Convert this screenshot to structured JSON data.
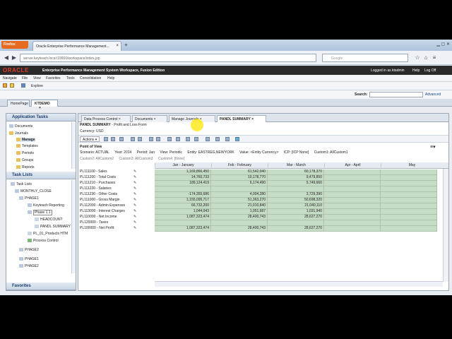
{
  "browser": {
    "firefox_button": "Firefox",
    "tab_title": "Oracle Enterprise Performance Management...",
    "url": "server.keyteach.local:19000/workspace/index.jsp",
    "search_placeholder": "Google"
  },
  "header": {
    "logo": "ORACLE",
    "app_title": "Enterprise Performance Management System Workspace, Fusion Edition",
    "logged_in": "Logged in as ktadmin",
    "help": "Help",
    "log_off": "Log Off"
  },
  "menu": [
    "Navigate",
    "File",
    "View",
    "Favorites",
    "Tools",
    "Consolidation",
    "Help"
  ],
  "toolbar": {
    "explore": "Explore"
  },
  "search": {
    "label": "Search:",
    "advanced": "Advanced"
  },
  "app_tabs": [
    "HomePage",
    "KTDEMO"
  ],
  "application_tasks": {
    "title": "Application Tasks",
    "items": [
      "Documents",
      "Journals",
      "Manage",
      "Templates",
      "Periods",
      "Groups",
      "Reports"
    ]
  },
  "task_lists": {
    "title": "Task Lists",
    "items": [
      "Task Lists",
      "MONTHLY_CLOSE",
      "PHASE1",
      "Keyteach Reporting",
      "Phase 1.1",
      "HEADCOUNT",
      "PANDL SUMMARY",
      "PL_01_Products HTM",
      "Process Control",
      "PHASE2",
      "PHASE1",
      "PHASE2"
    ]
  },
  "favorites": {
    "title": "Favorites"
  },
  "doc_tabs": [
    "Data Process Control",
    "Documents",
    "Manage Journals",
    "PANDL SUMMARY"
  ],
  "form": {
    "title_bold": "PANDL SUMMARY",
    "title_rest": " - Profit and Loss Form",
    "currency": "Currency: USD",
    "actions": "Actions",
    "pov_label": "Point of View",
    "pov_row1": [
      "Scenario: ACTUAL",
      "Year: 2014",
      "Period: Jan",
      "View: Periodic",
      "Entity: EASTREG.NEWYORK",
      "Value: <Entity Currency>",
      "ICP: [ICP None]",
      "Custom1: AllCustom1"
    ],
    "pov_row2": [
      "Custom2: AllCustom2",
      "Custom3: AllCustom3",
      "Custom4: [None]"
    ]
  },
  "grid": {
    "columns": [
      "Jan - January",
      "Feb - February",
      "Mar - March",
      "Apr - April",
      "May"
    ],
    "rows": [
      {
        "label": "PL111100 - Sales",
        "values": [
          "1,169,866,450",
          "61,542,040",
          "60,178,370",
          "",
          ""
        ]
      },
      {
        "label": "PL111200 - Total Costs",
        "values": [
          "14,760,733",
          "10,178,770",
          "9,479,850",
          "",
          ""
        ]
      },
      {
        "label": "PL111210 - Purchases",
        "values": [
          "189,124,419",
          "6,174,490",
          "5,749,660",
          "",
          ""
        ]
      },
      {
        "label": "PL111220 - Salaries",
        "values": [
          "",
          "",
          "",
          "",
          ""
        ]
      },
      {
        "label": "PL111230 - Other Costs",
        "values": [
          "-174,355,686",
          "4,004,280",
          "3,729,390",
          "",
          ""
        ]
      },
      {
        "label": "PL111000 - Gross Margin",
        "values": [
          "1,155,095,717",
          "51,363,270",
          "50,698,320",
          "",
          ""
        ]
      },
      {
        "label": "PL112000 - Admin Expenses",
        "values": [
          "66,732,200",
          "21,910,840",
          "21,040,110",
          "",
          ""
        ]
      },
      {
        "label": "PL113000 - Interest Charges",
        "values": [
          "1,044,043",
          "1,051,687",
          "1,031,940",
          "",
          ""
        ]
      },
      {
        "label": "PL110000 - Net Income",
        "values": [
          "1,087,323,474",
          "28,400,743",
          "28,627,270",
          "",
          ""
        ]
      },
      {
        "label": "PL120000 - Taxes",
        "values": [
          "",
          "",
          "",
          "",
          ""
        ]
      },
      {
        "label": "PL100000 - Net Profit",
        "values": [
          "1,087,323,474",
          "28,400,743",
          "28,627,270",
          "",
          ""
        ]
      }
    ]
  }
}
